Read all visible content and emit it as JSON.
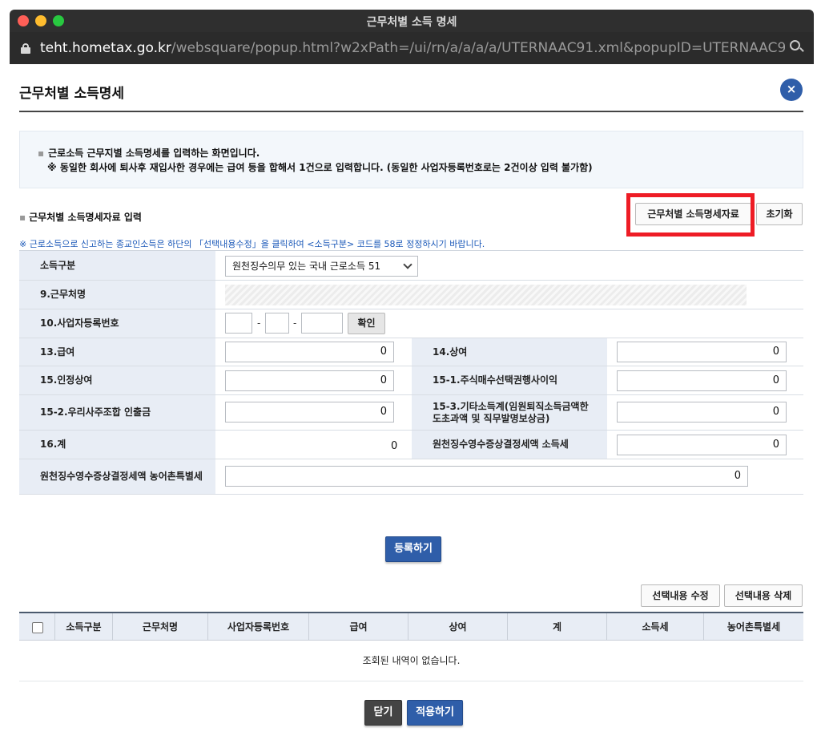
{
  "window": {
    "title": "근무처별 소득 명세",
    "url_domain": "teht.hometax.go.kr",
    "url_path": "/websquare/popup.html?w2xPath=/ui/rn/a/a/a/a/UTERNAAC91.xml&popupID=UTERNAAC9..."
  },
  "page": {
    "title": "근무처별 소득명세",
    "close_label": "×"
  },
  "info": {
    "line1": "근로소득 근무지별 소득명세를 입력하는 화면입니다.",
    "line2": "※ 동일한 회사에 퇴사후 재입사한 경우에는 급여 등을 합해서 1건으로 입력합니다. (동일한 사업자등록번호로는 2건이상 입력 불가함)"
  },
  "section": {
    "title": "근무처별 소득명세자료 입력",
    "load_button": "근무처별 소득명세자료",
    "reset_button": "초기화",
    "notice": "※ 근로소득으로 신고하는 종교인소득은 하단의 「선택내용수정」을 클릭하여 <소득구분> 코드를 58로 정정하시기 바랍니다."
  },
  "form": {
    "income_type_label": "소득구분",
    "income_type_value": "원천징수의무 있는 국내 근로소득 51",
    "workplace_label": "9.근무처명",
    "bizno_label": "10.사업자등록번호",
    "bizno_dash": "-",
    "confirm_button": "확인",
    "salary_label": "13.급여",
    "salary_value": "0",
    "bonus_label": "14.상여",
    "bonus_value": "0",
    "recognized_bonus_label": "15.인정상여",
    "recognized_bonus_value": "0",
    "stock_option_label": "15-1.주식매수선택권행사이익",
    "stock_option_value": "0",
    "esop_label": "15-2.우리사주조합 인출금",
    "esop_value": "0",
    "other_income_label": "15-3.기타소득계(임원퇴직소득금액한도초과액 및 직무발명보상금)",
    "other_income_value": "0",
    "total_label": "16.계",
    "total_value": "0",
    "withholding_tax_label": "원천징수영수증상결정세액 소득세",
    "withholding_tax_value": "0",
    "rural_tax_label": "원천징수영수증상결정세액 농어촌특별세",
    "rural_tax_value": "0"
  },
  "actions": {
    "register": "등록하기",
    "edit_selected": "선택내용 수정",
    "delete_selected": "선택내용 삭제",
    "close": "닫기",
    "apply": "적용하기"
  },
  "table": {
    "columns": [
      "소득구분",
      "근무처명",
      "사업자등록번호",
      "급여",
      "상여",
      "계",
      "소득세",
      "농어촌특별세"
    ],
    "empty_message": "조회된 내역이 없습니다."
  },
  "colors": {
    "accent_blue": "#2f5ea9",
    "highlight_red": "#ee1c25",
    "label_bg": "#e8edf5",
    "notice_blue": "#1a58b8"
  }
}
